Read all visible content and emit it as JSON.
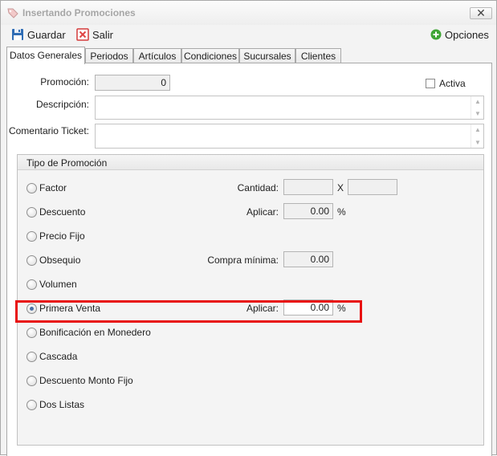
{
  "window": {
    "title": "Insertando Promociones",
    "close_label": "✕"
  },
  "toolbar": {
    "save_label": "Guardar",
    "exit_label": "Salir",
    "options_label": "Opciones"
  },
  "tabs": [
    {
      "label": "Datos Generales",
      "active": true
    },
    {
      "label": "Periodos"
    },
    {
      "label": "Artículos"
    },
    {
      "label": "Condiciones"
    },
    {
      "label": "Sucursales"
    },
    {
      "label": "Clientes"
    }
  ],
  "general": {
    "promocion_label": "Promoción:",
    "promocion_value": "0",
    "activa_label": "Activa",
    "descripcion_label": "Descripción:",
    "comentario_label": "Comentario Ticket:"
  },
  "tipo": {
    "header": "Tipo de Promoción",
    "options": [
      {
        "label": "Factor"
      },
      {
        "label": "Descuento"
      },
      {
        "label": "Precio Fijo"
      },
      {
        "label": "Obsequio"
      },
      {
        "label": "Volumen"
      },
      {
        "label": "Primera Venta",
        "selected": true
      },
      {
        "label": "Bonificación en Monedero"
      },
      {
        "label": "Cascada"
      },
      {
        "label": "Descuento Monto Fijo"
      },
      {
        "label": "Dos Listas"
      }
    ],
    "cantidad_label": "Cantidad:",
    "x_label": "X",
    "aplicar_label": "Aplicar:",
    "aplicar_value": "0.00",
    "percent": "%",
    "compra_label": "Compra mínima:",
    "compra_value": "0.00",
    "aplicar2_label": "Aplicar:",
    "aplicar2_value": "0.00",
    "percent2": "%"
  },
  "colors": {
    "highlight": "#e81010",
    "options_icon": "#3fa535",
    "exit_icon": "#e04545",
    "save_icon": "#2f6db5"
  }
}
